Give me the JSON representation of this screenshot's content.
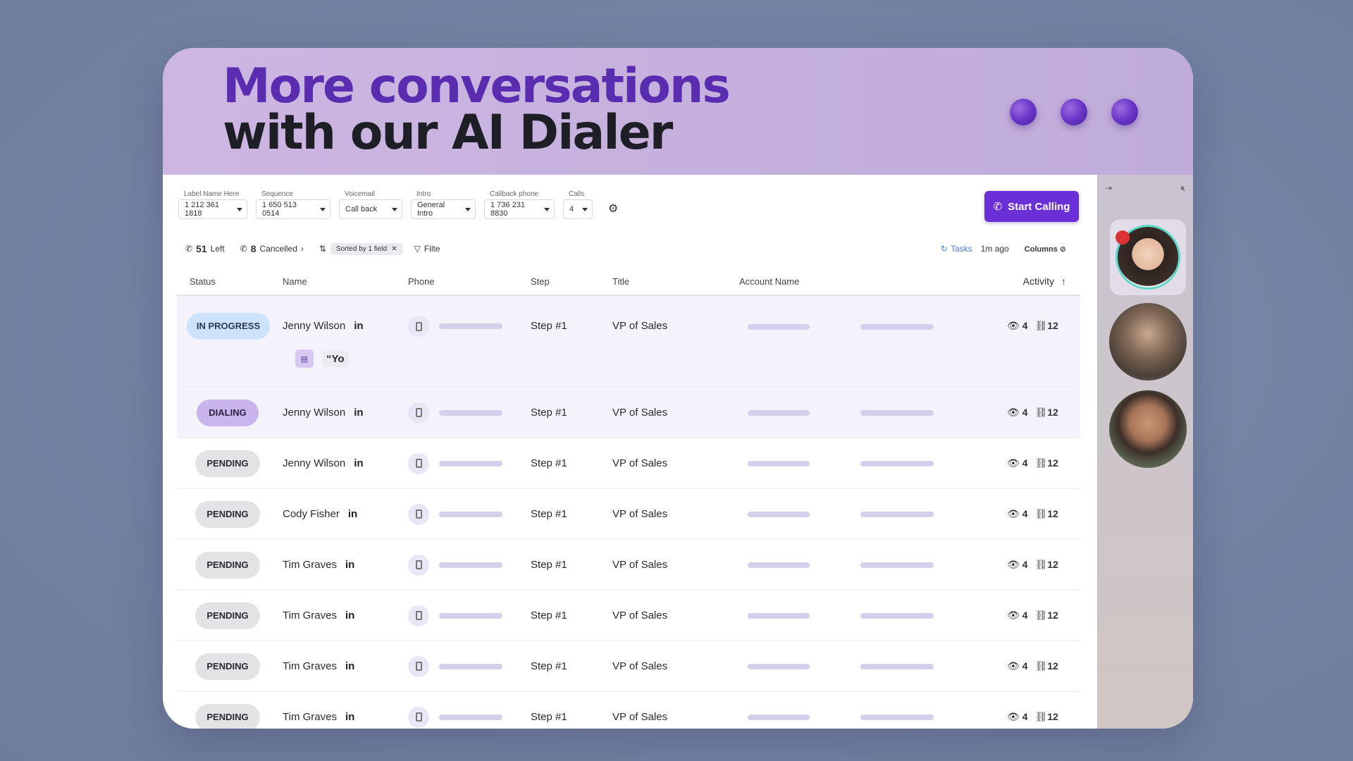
{
  "hero": {
    "line1": "More conversations",
    "line2": "with our AI Dialer"
  },
  "toolbar": {
    "fields": [
      {
        "label": "Label Name Here",
        "value": "1 212 361 1818"
      },
      {
        "label": "Sequence",
        "value": "1 650 513 0514"
      },
      {
        "label": "Voicemail",
        "value": "Call back"
      },
      {
        "label": "Intro",
        "value": "General Intro"
      },
      {
        "label": "Callback phone",
        "value": "1 736 231 8830"
      },
      {
        "label": "Calls",
        "value": "4"
      }
    ],
    "start_label": "Start Calling"
  },
  "bar2": {
    "left_count": "51",
    "left_label": "Left",
    "cancelled_count": "8",
    "cancelled_label": "Cancelled",
    "sorted_label": "Sorted by 1 field",
    "filter_label": "Filte",
    "tasks_label": "Tasks",
    "updated": "1m ago",
    "columns_label": "Columns"
  },
  "table": {
    "headers": {
      "status": "Status",
      "name": "Name",
      "phone": "Phone",
      "step": "Step",
      "title": "Title",
      "account": "Account Name",
      "activity": "Activity"
    },
    "rows": [
      {
        "status": "IN PROGRESS",
        "name": "Jenny Wilson",
        "linkedin": "in",
        "step": "Step #1",
        "title": "VP of Sales",
        "views": "4",
        "links": "12",
        "snippet": "“Yo"
      },
      {
        "status": "DIALING",
        "name": "Jenny Wilson",
        "linkedin": "in",
        "step": "Step #1",
        "title": "VP of Sales",
        "views": "4",
        "links": "12"
      },
      {
        "status": "PENDING",
        "name": "Jenny Wilson",
        "linkedin": "in",
        "step": "Step #1",
        "title": "VP of Sales",
        "views": "4",
        "links": "12"
      },
      {
        "status": "PENDING",
        "name": "Cody Fisher",
        "linkedin": "in",
        "step": "Step #1",
        "title": "VP of Sales",
        "views": "4",
        "links": "12"
      },
      {
        "status": "PENDING",
        "name": "Tim Graves",
        "linkedin": "in",
        "step": "Step #1",
        "title": "VP of Sales",
        "views": "4",
        "links": "12"
      },
      {
        "status": "PENDING",
        "name": "Tim Graves",
        "linkedin": "in",
        "step": "Step #1",
        "title": "VP of Sales",
        "views": "4",
        "links": "12"
      },
      {
        "status": "PENDING",
        "name": "Tim Graves",
        "linkedin": "in",
        "step": "Step #1",
        "title": "VP of Sales",
        "views": "4",
        "links": "12"
      },
      {
        "status": "PENDING",
        "name": "Tim Graves",
        "linkedin": "in",
        "step": "Step #1",
        "title": "VP of Sales",
        "views": "4",
        "links": "12"
      }
    ]
  },
  "panel": {
    "collapse_icon": "collapse-panel-icon",
    "mute_icon": "speaker-mute-icon"
  },
  "colors": {
    "accent": "#6a2fd6",
    "hero_bg": "#c5b0dd",
    "in_progress": "#cde3fb",
    "dialing": "#c9b4ee",
    "pending": "#e3e3e6"
  }
}
